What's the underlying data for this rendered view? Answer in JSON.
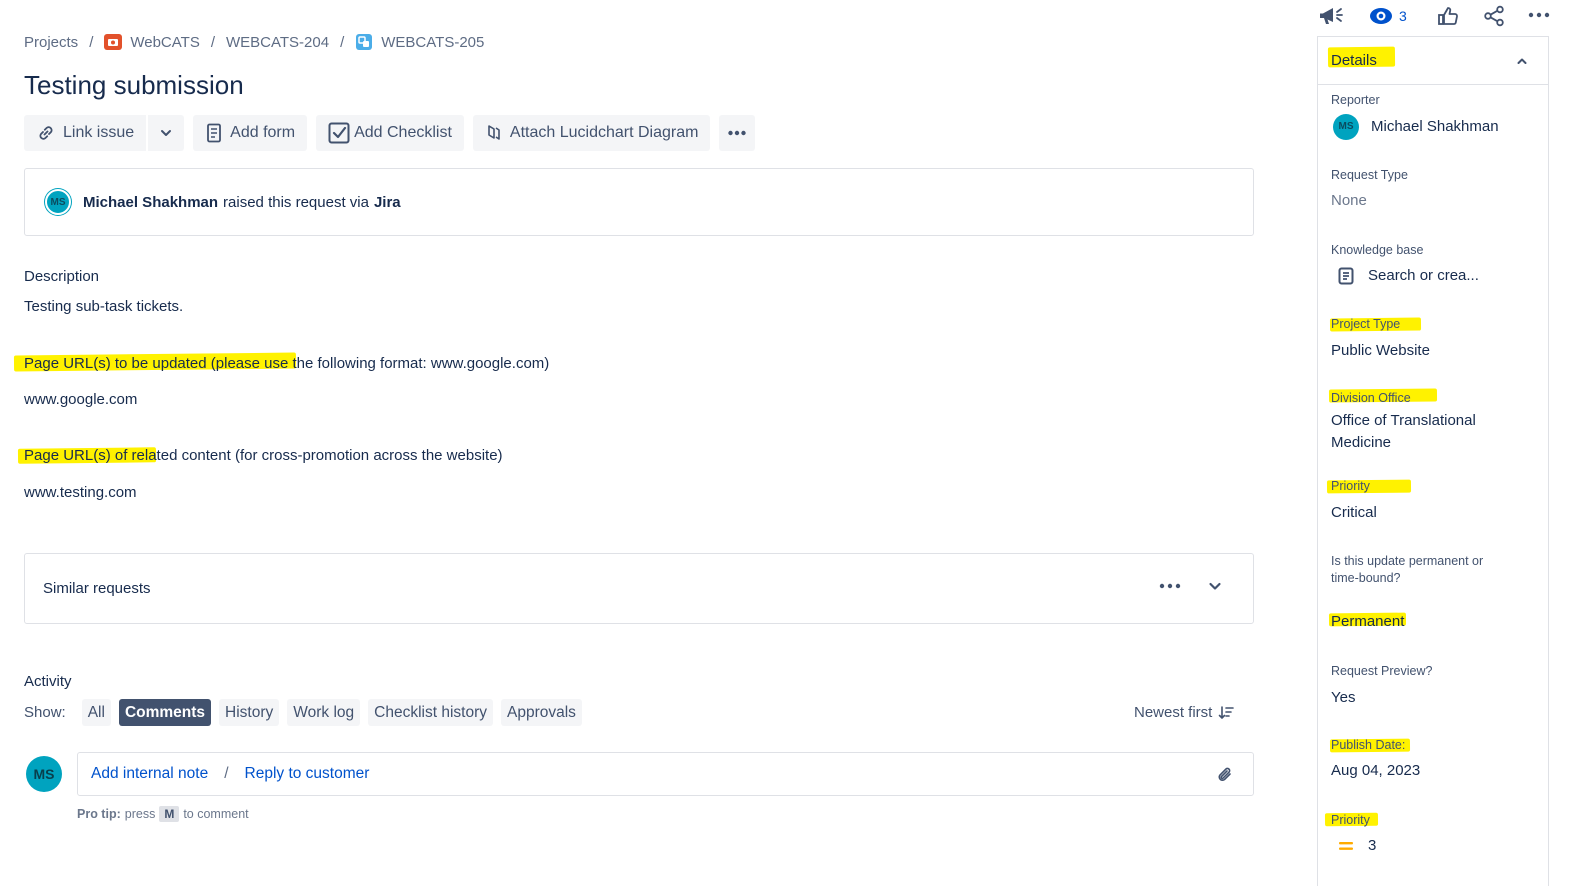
{
  "breadcrumb": {
    "projects": "Projects",
    "project": "WebCATS",
    "parent": "WEBCATS-204",
    "issue": "WEBCATS-205"
  },
  "title": "Testing submission",
  "toolbar": {
    "link_issue": "Link issue",
    "add_form": "Add form",
    "add_checklist": "Add Checklist",
    "attach_lucidchart": "Attach Lucidchart Diagram"
  },
  "raised": {
    "user": "Michael Shakhman",
    "text": "raised this request via",
    "channel": "Jira",
    "initials": "MS"
  },
  "description": {
    "label": "Description",
    "text": "Testing sub-task tickets."
  },
  "fields": {
    "page_urls_label": "Page URL(s) to be updated (please use the following format: www.google.com)",
    "page_urls_value": "www.google.com",
    "related_label": "Page URL(s) of related content (for cross-promotion across the website)",
    "related_value": "www.testing.com"
  },
  "similar": {
    "label": "Similar requests"
  },
  "activity": {
    "label": "Activity",
    "show": "Show:",
    "filters": [
      "All",
      "Comments",
      "History",
      "Work log",
      "Checklist history",
      "Approvals"
    ],
    "active_filter": "Comments",
    "sort": "Newest first"
  },
  "comment": {
    "initials": "MS",
    "add_internal": "Add internal note",
    "separator": "/",
    "reply": "Reply to customer",
    "protip_label": "Pro tip:",
    "protip_press": "press",
    "protip_key": "M",
    "protip_rest": "to comment"
  },
  "top_icons": {
    "watch_count": "3"
  },
  "details": {
    "header": "Details",
    "reporter_label": "Reporter",
    "reporter_value": "Michael Shakhman",
    "reporter_initials": "MS",
    "request_type_label": "Request Type",
    "request_type_value": "None",
    "kb_label": "Knowledge base",
    "kb_value": "Search or crea...",
    "project_type_label": "Project Type",
    "project_type_value": "Public Website",
    "division_label": "Division Office",
    "division_value": "Office of Translational Medicine",
    "priority_label": "Priority",
    "priority_value": "Critical",
    "permanent_label": "Is this update permanent or time-bound?",
    "permanent_value": "Permanent",
    "preview_label": "Request Preview?",
    "preview_value": "Yes",
    "publish_label": "Publish Date:",
    "publish_value": "Aug 04, 2023",
    "priority2_label": "Priority",
    "priority2_value": "3"
  },
  "colors": {
    "highlight": "#fff200",
    "avatar": "#00a3bf",
    "link": "#0052cc",
    "active_chip": "#42526e"
  }
}
